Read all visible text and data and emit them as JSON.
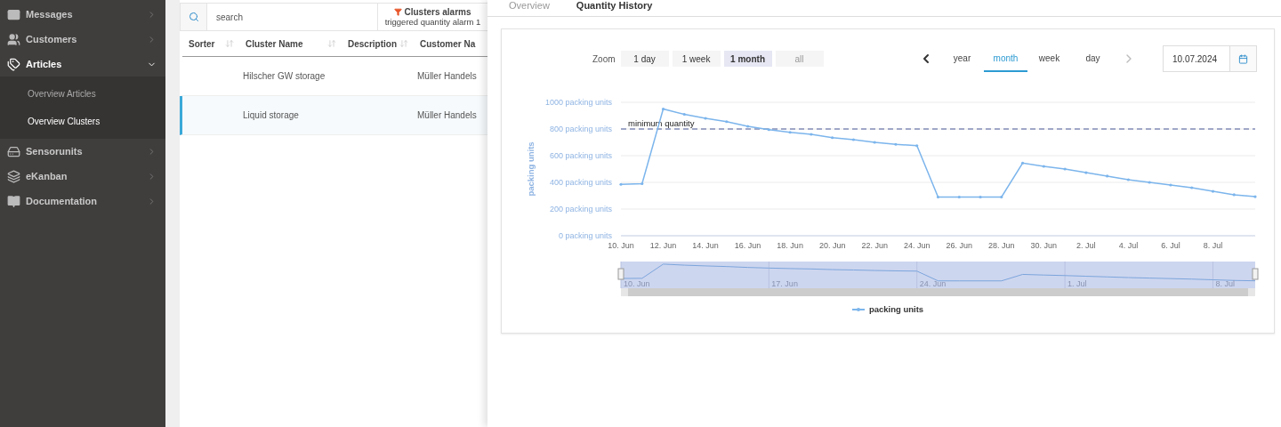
{
  "sidebar": {
    "items": [
      {
        "kind": "mail",
        "label": "Messages",
        "expanded": false
      },
      {
        "kind": "users",
        "label": "Customers",
        "expanded": false
      },
      {
        "kind": "tags",
        "label": "Articles",
        "expanded": true,
        "children": [
          {
            "label": "Overview Articles",
            "selected": false
          },
          {
            "label": "Overview Clusters",
            "selected": true
          }
        ]
      },
      {
        "kind": "drive",
        "label": "Sensorunits",
        "expanded": false
      },
      {
        "kind": "layers",
        "label": "eKanban",
        "expanded": false
      },
      {
        "kind": "book",
        "label": "Documentation",
        "expanded": false
      }
    ]
  },
  "list": {
    "search": {
      "placeholder": "search"
    },
    "filter": {
      "title": "Clusters alarms",
      "subtitle": "triggered quantity alarm 1"
    },
    "columns": [
      "Sorter",
      "Cluster Name",
      "Description",
      "Customer Na"
    ],
    "rows": [
      {
        "cells": [
          "",
          "Hilscher GW storage",
          "",
          "Müller Handels"
        ],
        "selected": false
      },
      {
        "cells": [
          "",
          "Liquid storage",
          "",
          "Müller Handels"
        ],
        "selected": true
      }
    ]
  },
  "detail": {
    "tabs": [
      {
        "label": "Overview",
        "selected": false
      },
      {
        "label": "Quantity History",
        "selected": true
      }
    ],
    "zoom": {
      "label": "Zoom",
      "options": [
        {
          "label": "1 day",
          "selected": false,
          "disabled": false
        },
        {
          "label": "1 week",
          "selected": false,
          "disabled": false
        },
        {
          "label": "1 month",
          "selected": true,
          "disabled": false
        },
        {
          "label": "all",
          "selected": false,
          "disabled": true
        }
      ]
    },
    "periods": [
      {
        "label": "year",
        "selected": false
      },
      {
        "label": "month",
        "selected": true
      },
      {
        "label": "week",
        "selected": false
      },
      {
        "label": "day",
        "selected": false
      }
    ],
    "date": {
      "value": "10.07.2024"
    },
    "chart_data": {
      "type": "line",
      "ylabel": "packing units",
      "grid": true,
      "categories": [
        "10. Jun",
        null,
        "12. Jun",
        null,
        "14. Jun",
        null,
        "16. Jun",
        null,
        "18. Jun",
        null,
        "20. Jun",
        null,
        "22. Jun",
        null,
        "24. Jun",
        null,
        "26. Jun",
        null,
        "28. Jun",
        null,
        "30. Jun",
        null,
        "2. Jul",
        null,
        "4. Jul",
        null,
        "6. Jul",
        null,
        "8. Jul",
        null,
        null
      ],
      "series": [
        {
          "name": "packing units",
          "color": "#7cb5ec",
          "values": [
            385,
            390,
            950,
            910,
            880,
            855,
            820,
            795,
            775,
            760,
            735,
            720,
            700,
            685,
            675,
            290,
            290,
            290,
            290,
            545,
            520,
            500,
            473,
            447,
            420,
            400,
            380,
            360,
            333,
            307,
            293
          ]
        }
      ],
      "ylim": [
        0,
        1000
      ],
      "yticks": [
        {
          "value": 0,
          "label": "0 packing units"
        },
        {
          "value": 200,
          "label": "200 packing units"
        },
        {
          "value": 400,
          "label": "400 packing units"
        },
        {
          "value": 600,
          "label": "600 packing units"
        },
        {
          "value": 800,
          "label": "800 packing units"
        },
        {
          "value": 1000,
          "label": "1000 packing units"
        }
      ],
      "ref_lines": [
        {
          "axis": "y",
          "value": 800,
          "label": "minimum quantity"
        }
      ]
    },
    "navigator": {
      "labels": [
        "10. Jun",
        "17. Jun",
        "24. Jun",
        "1. Jul",
        "8. Jul"
      ]
    }
  }
}
